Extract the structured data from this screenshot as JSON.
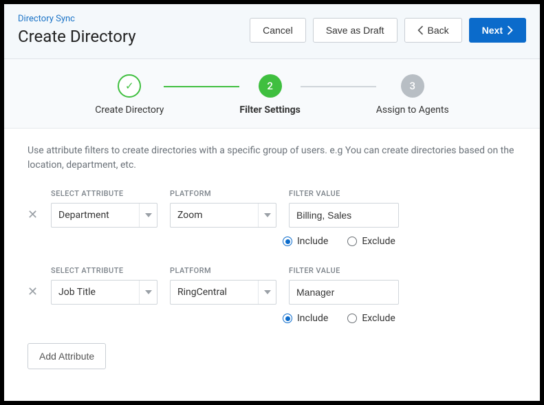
{
  "breadcrumb": "Directory Sync",
  "page_title": "Create Directory",
  "actions": {
    "cancel": "Cancel",
    "save_draft": "Save as Draft",
    "back": "Back",
    "next": "Next"
  },
  "steps": [
    {
      "label": "Create Directory",
      "state": "done",
      "indicator": "✓"
    },
    {
      "label": "Filter Settings",
      "state": "current",
      "indicator": "2"
    },
    {
      "label": "Assign to Agents",
      "state": "future",
      "indicator": "3"
    }
  ],
  "description": "Use attribute filters to create directories with a specific group of users. e.g You can create directories based on the location, department, etc.",
  "labels": {
    "select_attribute": "SELECT ATTRIBUTE",
    "platform": "PLATFORM",
    "filter_value": "FILTER VALUE",
    "include": "Include",
    "exclude": "Exclude",
    "add_attribute": "Add Attribute"
  },
  "filters": [
    {
      "attribute": "Department",
      "platform": "Zoom",
      "value": "Billing, Sales",
      "mode": "include"
    },
    {
      "attribute": "Job Title",
      "platform": "RingCentral",
      "value": "Manager",
      "mode": "include"
    }
  ]
}
